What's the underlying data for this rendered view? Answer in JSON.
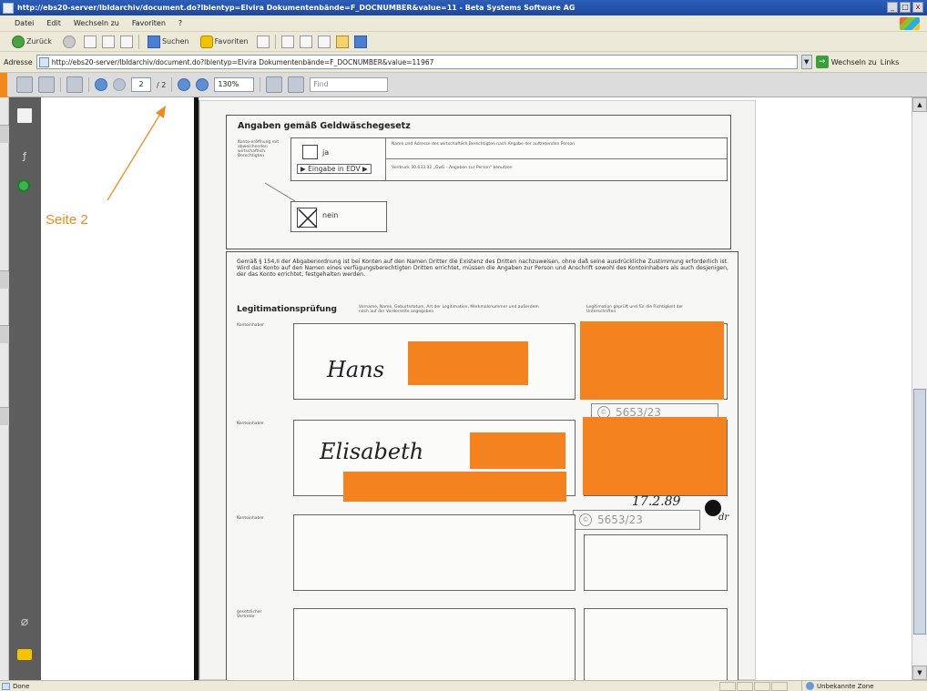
{
  "window": {
    "title": "http://ebs20-server/lbldarchiv/document.do?lblentyp=Elvira Dokumentenbände=F_DOCNUMBER&value=11 - Beta Systems Software AG",
    "buttons": {
      "minimize": "_",
      "maximize": "□",
      "close": "x"
    }
  },
  "menu": {
    "items": [
      "Datei",
      "Edit",
      "Wechseln zu",
      "Favoriten",
      "?"
    ]
  },
  "nav": {
    "back": "Zurück",
    "search": "Suchen",
    "favorites": "Favoriten"
  },
  "address": {
    "label": "Adresse",
    "url": "http://ebs20-server/lbldarchiv/document.do?lblentyp=Elvira Dokumentenbände=F_DOCNUMBER&value=11967",
    "go": "Wechseln zu",
    "links": "Links"
  },
  "pdf_toolbar": {
    "page_current": "2",
    "page_total": "/ 2",
    "zoom": "130%",
    "find_placeholder": "Find"
  },
  "annotation": {
    "label": "Seite 2",
    "color": "#f08a1c"
  },
  "document": {
    "section1_title": "Angaben gemäß Geldwäschegesetz",
    "section1_side": "Konto-eröffnung mit abweichenden wirtschaftlich Berechtigten",
    "ja_label": "ja",
    "edv_label": "▶ Eingabe in EDV ▶",
    "nein_label": "nein",
    "hint_top": "Name und Adresse des wirtschaftlich Berechtigten nach Angabe der auftretenden Person",
    "hint_bottom": "Vordruck 30.033.02 „GwG - Angaben zur Person\" benutzen",
    "paragraph": "Gemäß § 154,II der Abgabenordnung ist bei Konten auf den Namen Dritter die Existenz des Dritten nachzuweisen, ohne daß seine ausdrückliche Zustimmung erforderlich ist. Wird das Konto auf den Namen eines verfügungsberechtigten Dritten errichtet, müssen die Angaben zur Person und Anschrift sowohl des Kontoinhabers als auch desjenigen, der das Konto errichtet, festgehalten werden.",
    "legit_title": "Legitimationsprüfung",
    "legit_col2": "Vorname, Name, Geburtsdatum, Art der Legitimation, Merkmalsnummer und außerdem noch auf der Vorderseite angegeben",
    "legit_col3": "Legitimation geprüft und für die Richtigkeit der Unterschriften",
    "row_label_1": "Kontoinhaber",
    "row_label_2": "Kontoinhaber",
    "row_label_3": "Kontoinhaber",
    "row_label_4": "gesetzlicher Vertreter",
    "sig_1": "Hans",
    "sig_2": "Elisabeth",
    "stamp_1": "5653/23",
    "stamp_2": "5653/23",
    "date_note": "17.2.89",
    "initials": "dr",
    "redaction_color": "#f3821f"
  },
  "status": {
    "left": "Done",
    "zone": "Unbekannte Zone"
  }
}
